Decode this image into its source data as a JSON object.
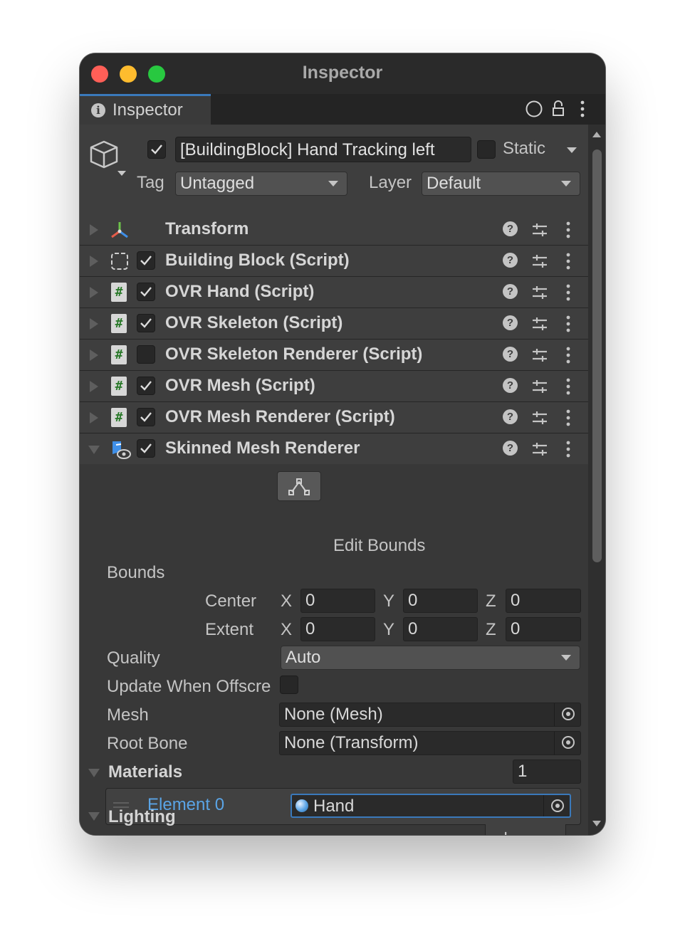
{
  "window": {
    "title": "Inspector"
  },
  "tab": {
    "label": "Inspector"
  },
  "header": {
    "active_checked": true,
    "object_name": "[BuildingBlock] Hand Tracking left",
    "static_label": "Static",
    "static_checked": false,
    "tag_label": "Tag",
    "tag_value": "Untagged",
    "layer_label": "Layer",
    "layer_value": "Default"
  },
  "components": [
    {
      "name": "Transform",
      "icon": "transform-axes-icon",
      "has_checkbox": false
    },
    {
      "name": "Building Block (Script)",
      "icon": "dashed-square-icon",
      "checked": true
    },
    {
      "name": "OVR Hand (Script)",
      "icon": "csharp-script-icon",
      "checked": true
    },
    {
      "name": "OVR Skeleton (Script)",
      "icon": "csharp-script-icon",
      "checked": true
    },
    {
      "name": "OVR Skeleton Renderer (Script)",
      "icon": "csharp-script-icon",
      "checked": false
    },
    {
      "name": "OVR Mesh (Script)",
      "icon": "csharp-script-icon",
      "checked": true
    },
    {
      "name": "OVR Mesh Renderer (Script)",
      "icon": "csharp-script-icon",
      "checked": true
    },
    {
      "name": "Skinned Mesh Renderer",
      "icon": "skinned-mesh-renderer-icon",
      "checked": true,
      "expanded": true
    }
  ],
  "smr": {
    "edit_bounds_label": "Edit Bounds",
    "bounds_label": "Bounds",
    "center_label": "Center",
    "extent_label": "Extent",
    "axis_x": "X",
    "axis_y": "Y",
    "axis_z": "Z",
    "center": {
      "x": "0",
      "y": "0",
      "z": "0"
    },
    "extent": {
      "x": "0",
      "y": "0",
      "z": "0"
    },
    "quality_label": "Quality",
    "quality_value": "Auto",
    "update_offscreen_label": "Update When Offscre",
    "update_offscreen_checked": false,
    "mesh_label": "Mesh",
    "mesh_value": "None (Mesh)",
    "root_bone_label": "Root Bone",
    "root_bone_value": "None (Transform)",
    "materials_label": "Materials",
    "materials_count": "1",
    "element_label": "Element 0",
    "element_value": "Hand",
    "add_label": "+",
    "remove_label": "−",
    "lighting_label": "Lighting"
  },
  "colors": {
    "accent": "#3a79bb",
    "element_label": "#5aa4e6",
    "script_hash": "#2b7a2b"
  }
}
